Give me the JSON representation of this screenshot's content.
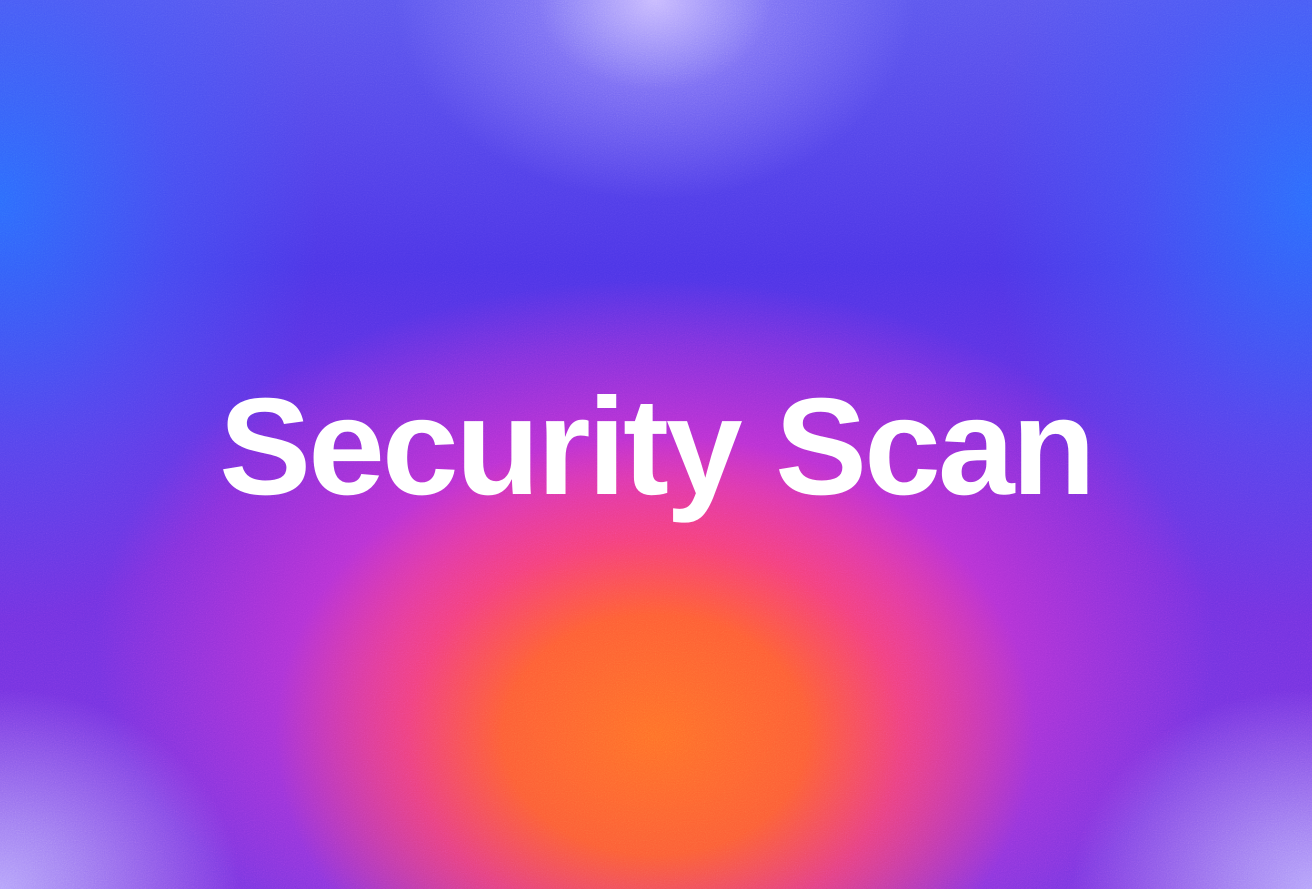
{
  "hero": {
    "title": "Security Scan",
    "title_color": "#ffffff"
  },
  "background": {
    "style": "grainy-gradient",
    "colors": {
      "blue": "#3a6cff",
      "violet": "#5a35e6",
      "magenta": "#f02fb4",
      "orange": "#ff6a2a",
      "lavender": "#c8bcff"
    }
  }
}
